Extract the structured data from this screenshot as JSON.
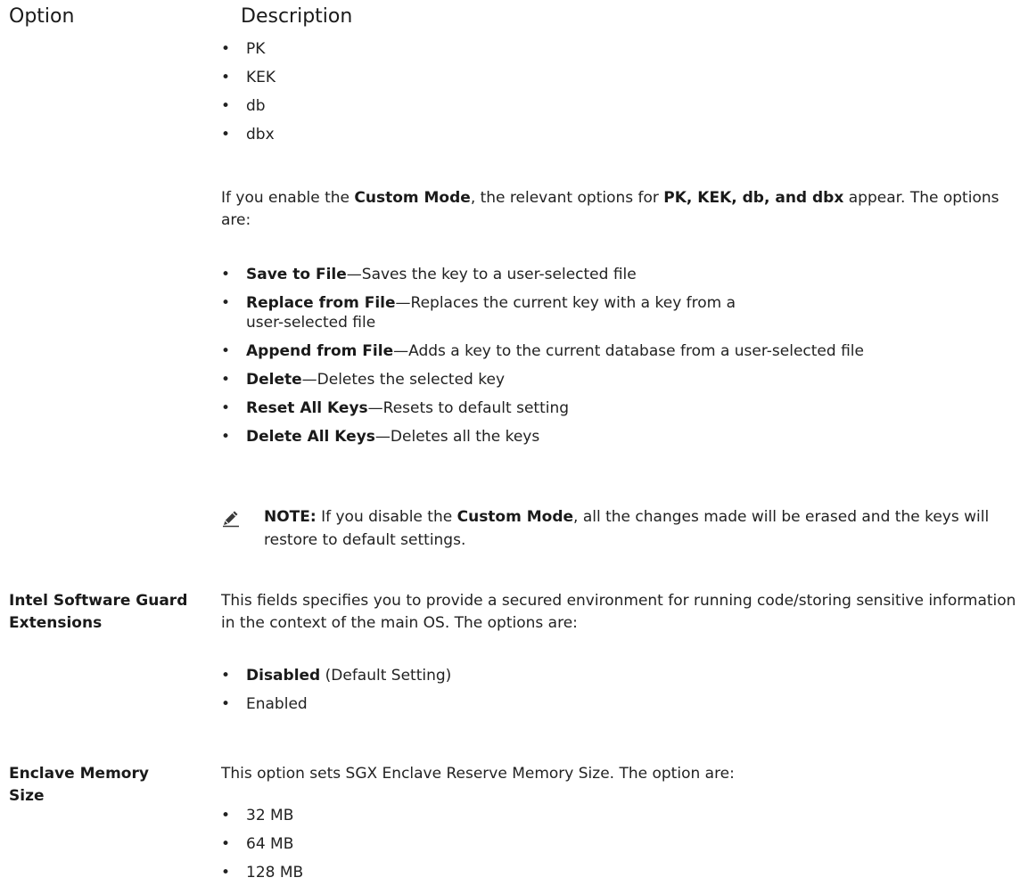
{
  "header": {
    "option": "Option",
    "description": "Description"
  },
  "secure_boot_keys": [
    "PK",
    "KEK",
    "db",
    "dbx"
  ],
  "custom_mode_para": {
    "p1": "If you enable the ",
    "b1": "Custom Mode",
    "p2": ", the relevant options for ",
    "b2": "PK, KEK, db, and dbx",
    "p3": " appear. The options are:"
  },
  "key_options": [
    {
      "name": "Save to File",
      "desc": "—Saves the key to a user-selected file"
    },
    {
      "name": "Replace from File",
      "desc": "—Replaces the current key with a key from a user-selected file"
    },
    {
      "name": "Append from File",
      "desc": "—Adds a key to the current database from a user-selected file"
    },
    {
      "name": "Delete",
      "desc": "—Deletes the selected key"
    },
    {
      "name": "Reset All Keys",
      "desc": "—Resets to default setting"
    },
    {
      "name": "Delete All Keys",
      "desc": "—Deletes all the keys"
    }
  ],
  "note": {
    "label": "NOTE:",
    "p1": " If you disable the ",
    "b1": "Custom Mode",
    "p2": ", all the changes made will be erased and the keys will restore to default settings."
  },
  "sgx": {
    "name": "Intel Software Guard Extensions",
    "desc": "This fields specifies you to provide a secured environment for running code/storing sensitive information in the context of the main OS. The options are:",
    "options": [
      {
        "name": "Disabled",
        "suffix": " (Default Setting)"
      },
      {
        "name": "Enabled",
        "suffix": ""
      }
    ]
  },
  "enclave": {
    "name": "Enclave Memory Size",
    "desc": "This option sets SGX Enclave Reserve Memory Size. The option are:",
    "options": [
      "32 MB",
      "64 MB",
      "128 MB"
    ]
  }
}
